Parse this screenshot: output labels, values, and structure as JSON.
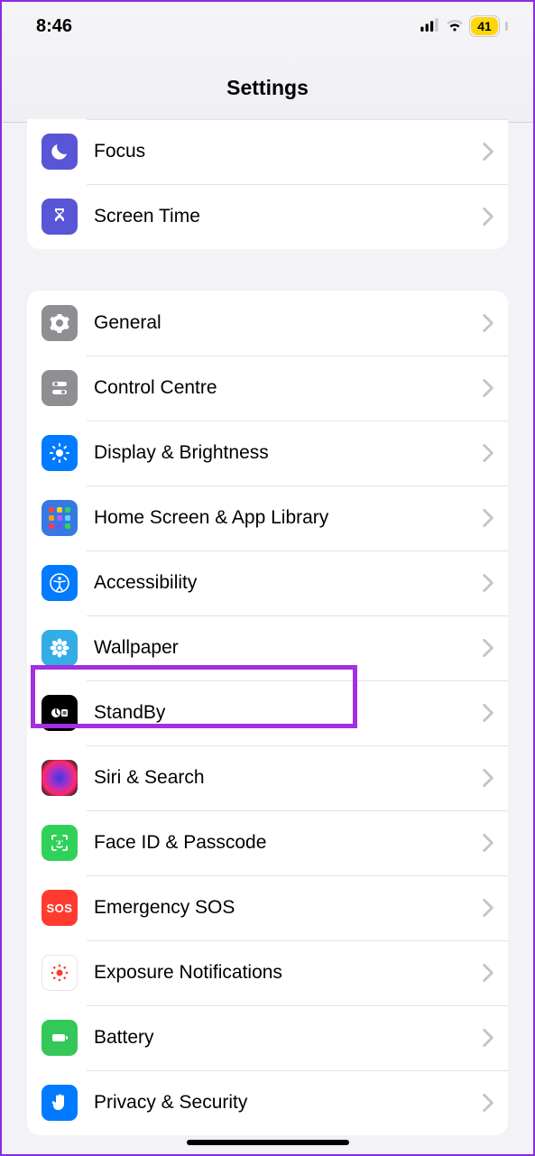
{
  "status": {
    "time": "8:46",
    "battery": "41"
  },
  "title": "Settings",
  "group1": [
    {
      "label": "Focus"
    },
    {
      "label": "Screen Time"
    }
  ],
  "group2": [
    {
      "label": "General"
    },
    {
      "label": "Control Centre"
    },
    {
      "label": "Display & Brightness"
    },
    {
      "label": "Home Screen & App Library"
    },
    {
      "label": "Accessibility"
    },
    {
      "label": "Wallpaper"
    },
    {
      "label": "StandBy"
    },
    {
      "label": "Siri & Search"
    },
    {
      "label": "Face ID & Passcode"
    },
    {
      "label": "Emergency SOS"
    },
    {
      "label": "Exposure Notifications"
    },
    {
      "label": "Battery"
    },
    {
      "label": "Privacy & Security"
    }
  ],
  "sos": "SOS"
}
